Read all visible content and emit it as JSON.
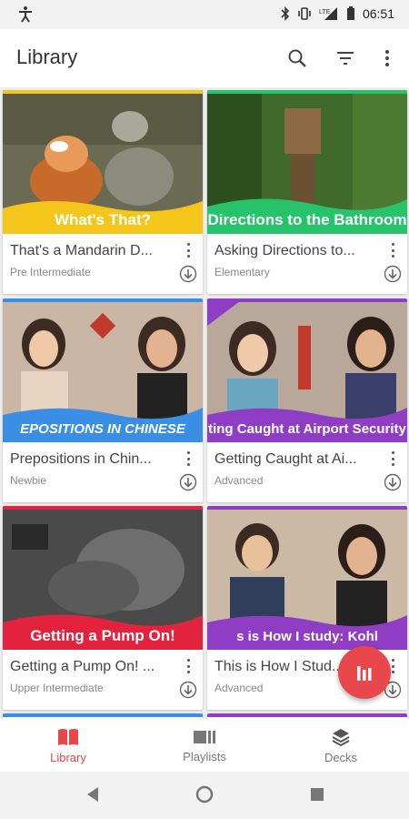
{
  "status_bar": {
    "time": "06:51",
    "network": "LTE"
  },
  "app_bar": {
    "title": "Library",
    "actions": [
      {
        "icon": "search-icon"
      },
      {
        "icon": "filter-icon"
      },
      {
        "icon": "more-vert-icon"
      }
    ]
  },
  "cards": [
    {
      "title": "That's a Mandarin D...",
      "level": "Pre Intermediate",
      "banner": "What's That?",
      "accent": "#f4c51b"
    },
    {
      "title": "Asking Directions to...",
      "level": "Elementary",
      "banner": "Directions to the Bathroom",
      "accent": "#27c36a"
    },
    {
      "title": "Prepositions in Chin...",
      "level": "Newbie",
      "banner": "EPOSITIONS IN CHINESE",
      "accent": "#3a8ee6"
    },
    {
      "title": "Getting Caught at Ai...",
      "level": "Advanced",
      "banner": "ting Caught at Airport Security",
      "accent": "#8e3dc4"
    },
    {
      "title": "Getting a Pump On! ...",
      "level": "Upper Intermediate",
      "banner": "Getting a Pump On!",
      "accent": "#e3223d"
    },
    {
      "title": "This is How I Stud...",
      "level": "Advanced",
      "banner": "s is How I study: Kohl",
      "accent": "#8e3dc4"
    }
  ],
  "bottom_nav": {
    "items": [
      {
        "label": "Library",
        "icon": "book-icon",
        "active": true
      },
      {
        "label": "Playlists",
        "icon": "playlist-icon",
        "active": false
      },
      {
        "label": "Decks",
        "icon": "layers-icon",
        "active": false
      }
    ]
  },
  "colors": {
    "accent": "#e8474b",
    "background": "#eeeeee"
  }
}
